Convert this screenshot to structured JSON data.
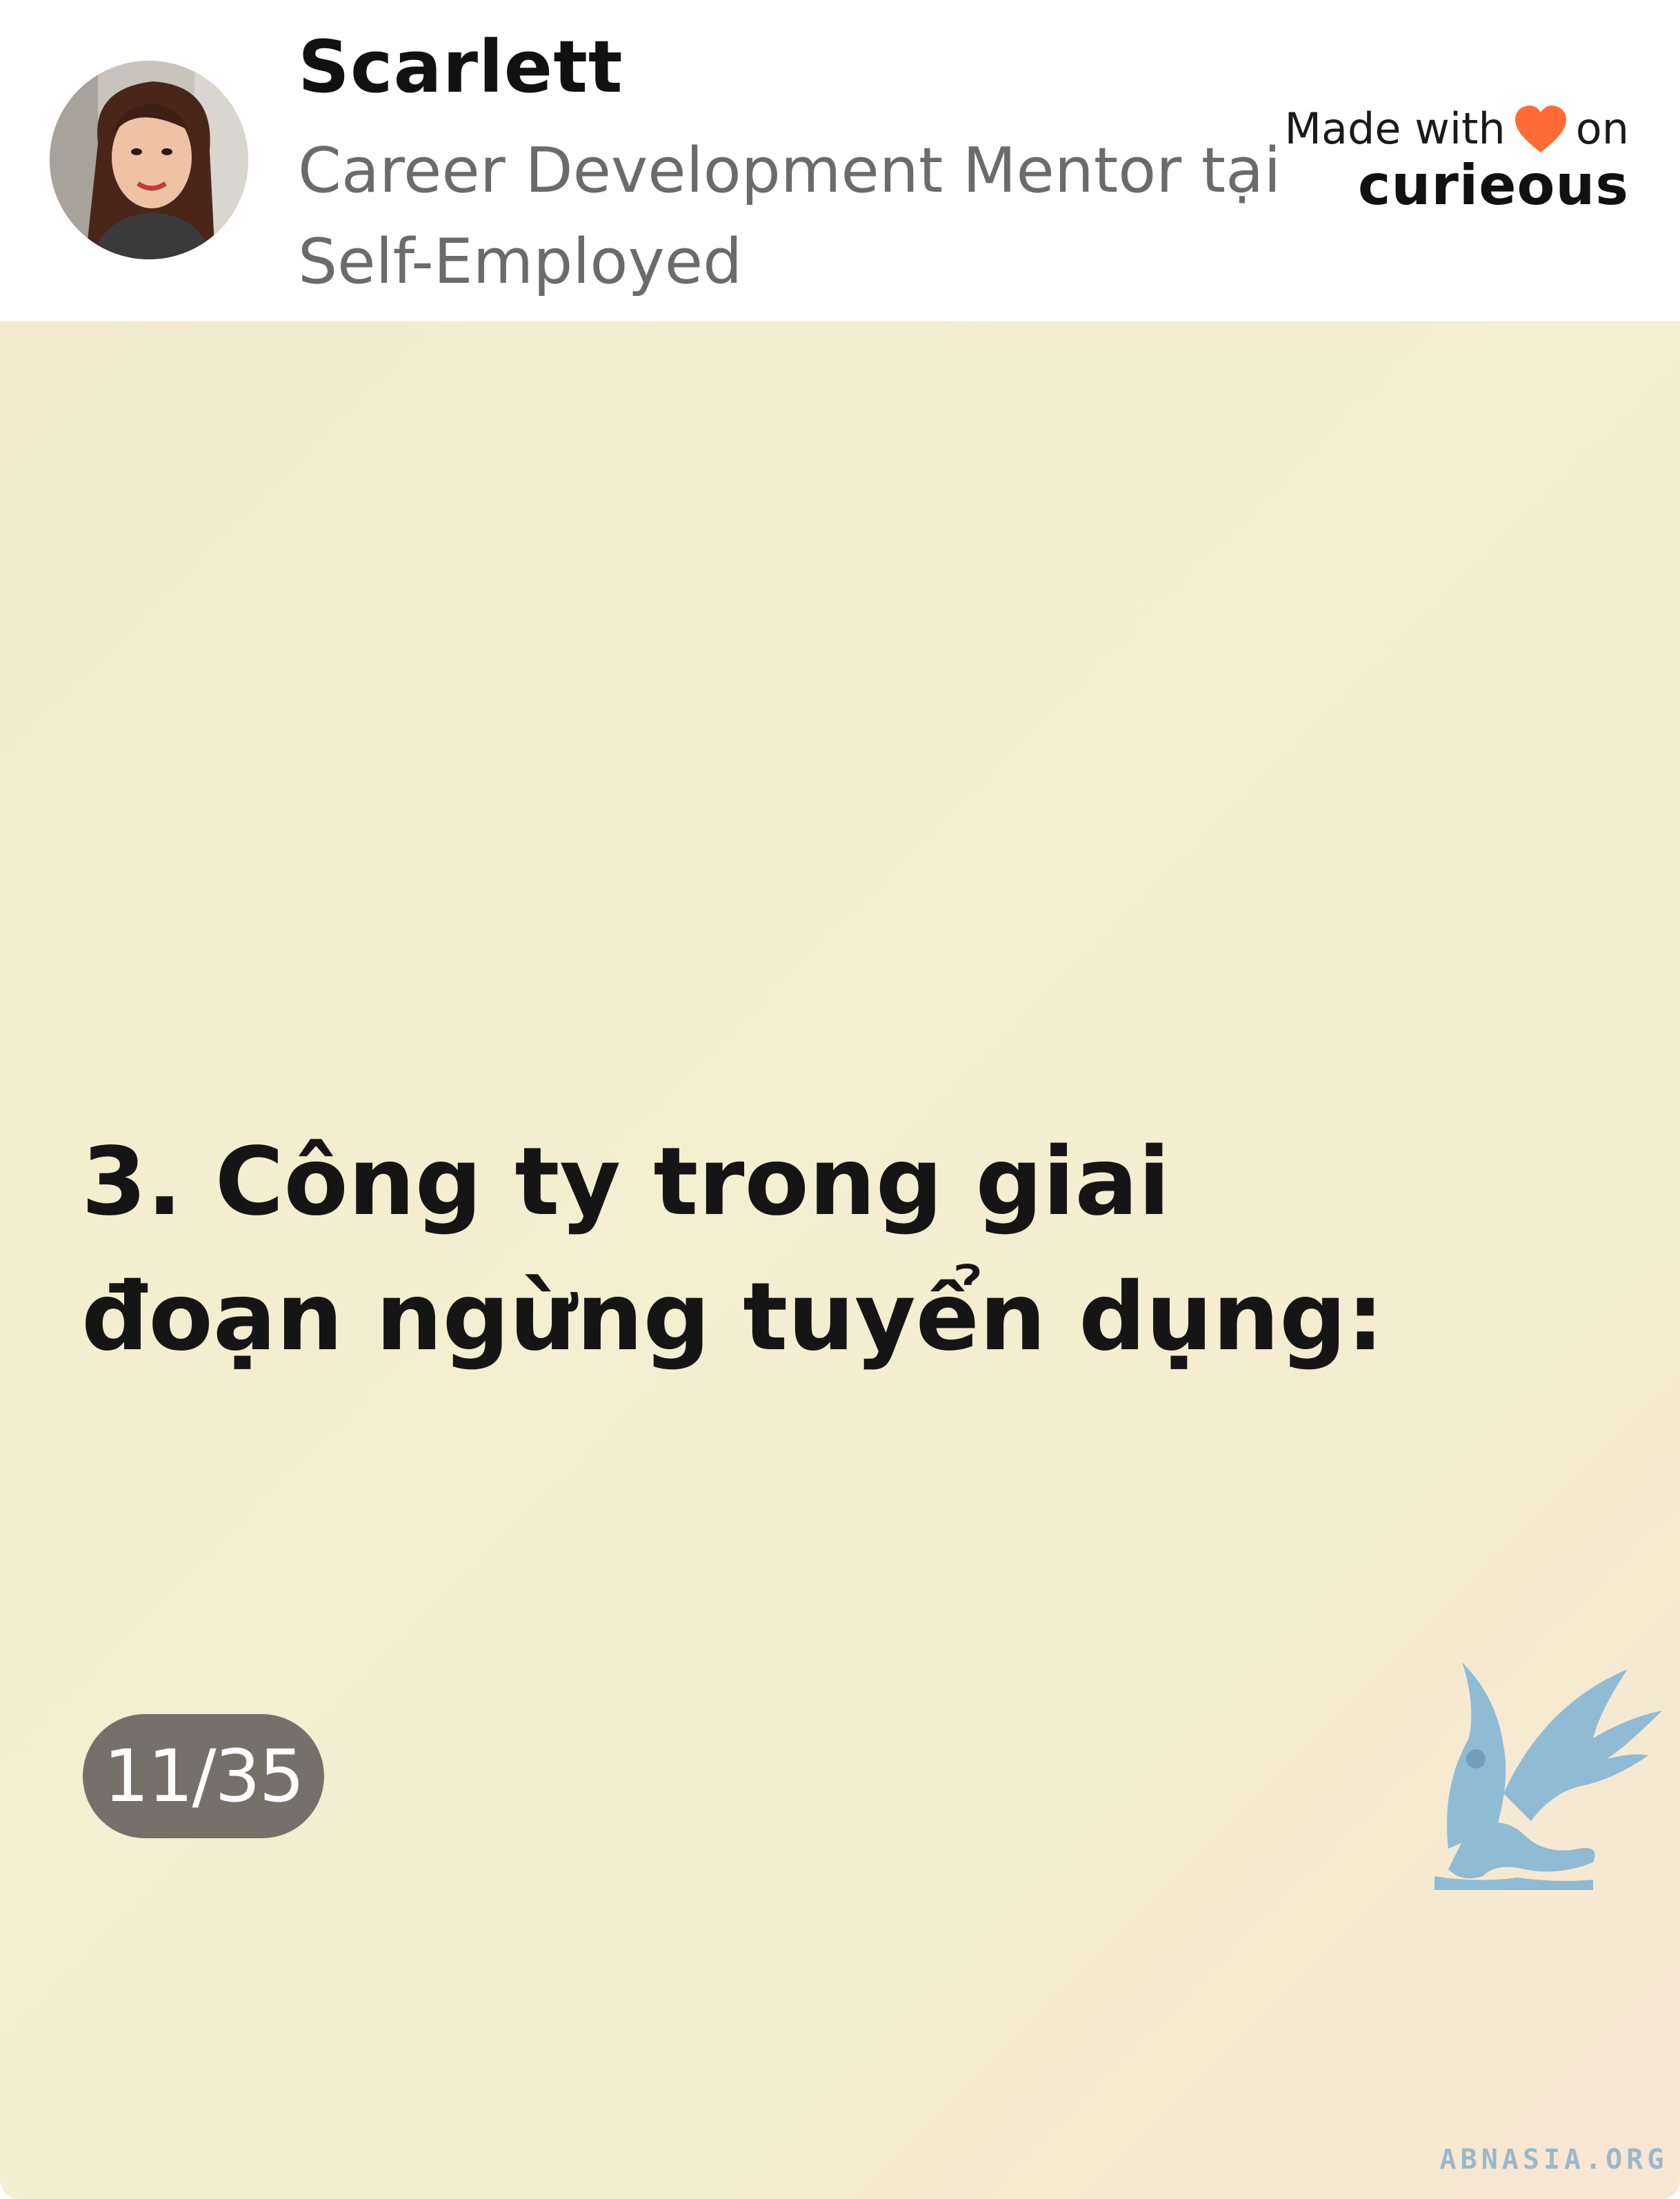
{
  "header": {
    "author_name": "Scarlett",
    "author_title": "Career Development Mentor tại Self-Employed",
    "made_with_prefix": "Made with",
    "made_with_suffix": "on",
    "brand": "curieous"
  },
  "slide": {
    "text": "3. Công ty trong giai đoạn ngừng tuyển dụng:",
    "page_indicator": "11/35"
  },
  "watermark": {
    "text": "ABNASIA.ORG",
    "icon": "griffin-logo-icon"
  },
  "colors": {
    "heart": "#ff6b35",
    "badge": "#76706b",
    "slide_background": "#f3edcd",
    "watermark": "#9ab8c8"
  }
}
